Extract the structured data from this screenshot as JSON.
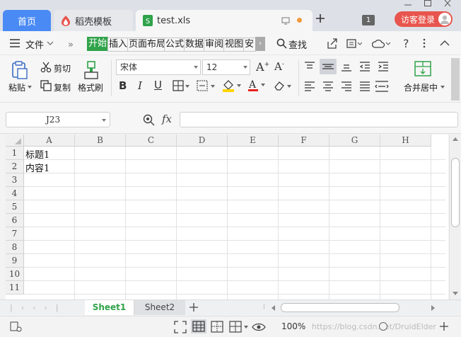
{
  "tabs": {
    "home": "首页",
    "docer": "稻壳模板",
    "file": "test.xls"
  },
  "title_bar": {
    "tab_count": "1",
    "login": "访客登录"
  },
  "menu": {
    "file": "文件",
    "items": [
      "开始",
      "插入",
      "页面布局",
      "公式",
      "数据",
      "审阅",
      "视图",
      "安"
    ],
    "active": "开始",
    "search": "查找"
  },
  "ribbon": {
    "paste": "粘贴",
    "cut": "剪切",
    "copy": "复制",
    "format_painter": "格式刷",
    "font_name": "宋体",
    "font_size": "12",
    "merge": "合并居中"
  },
  "formula_bar": {
    "cell_ref": "J23",
    "fx": "fx",
    "formula": ""
  },
  "grid": {
    "columns": [
      "A",
      "B",
      "C",
      "D",
      "E",
      "F",
      "G",
      "H"
    ],
    "rows": [
      "1",
      "2",
      "3",
      "4",
      "5",
      "6",
      "7",
      "8",
      "9",
      "10",
      "11"
    ],
    "cells": [
      {
        "ref": "A1",
        "value": "标题1"
      },
      {
        "ref": "A2",
        "value": "内容1"
      }
    ]
  },
  "sheets": [
    "Sheet1",
    "Sheet2"
  ],
  "active_sheet": "Sheet1",
  "status": {
    "zoom": "100%",
    "watermark": "https://blog.csdn.net/DruidElder"
  },
  "colors": {
    "accent_blue": "#4a8af4",
    "active_tab_green": "#2fa34a",
    "login_red": "#e8554e",
    "file_icon_green": "#2fa34a"
  }
}
